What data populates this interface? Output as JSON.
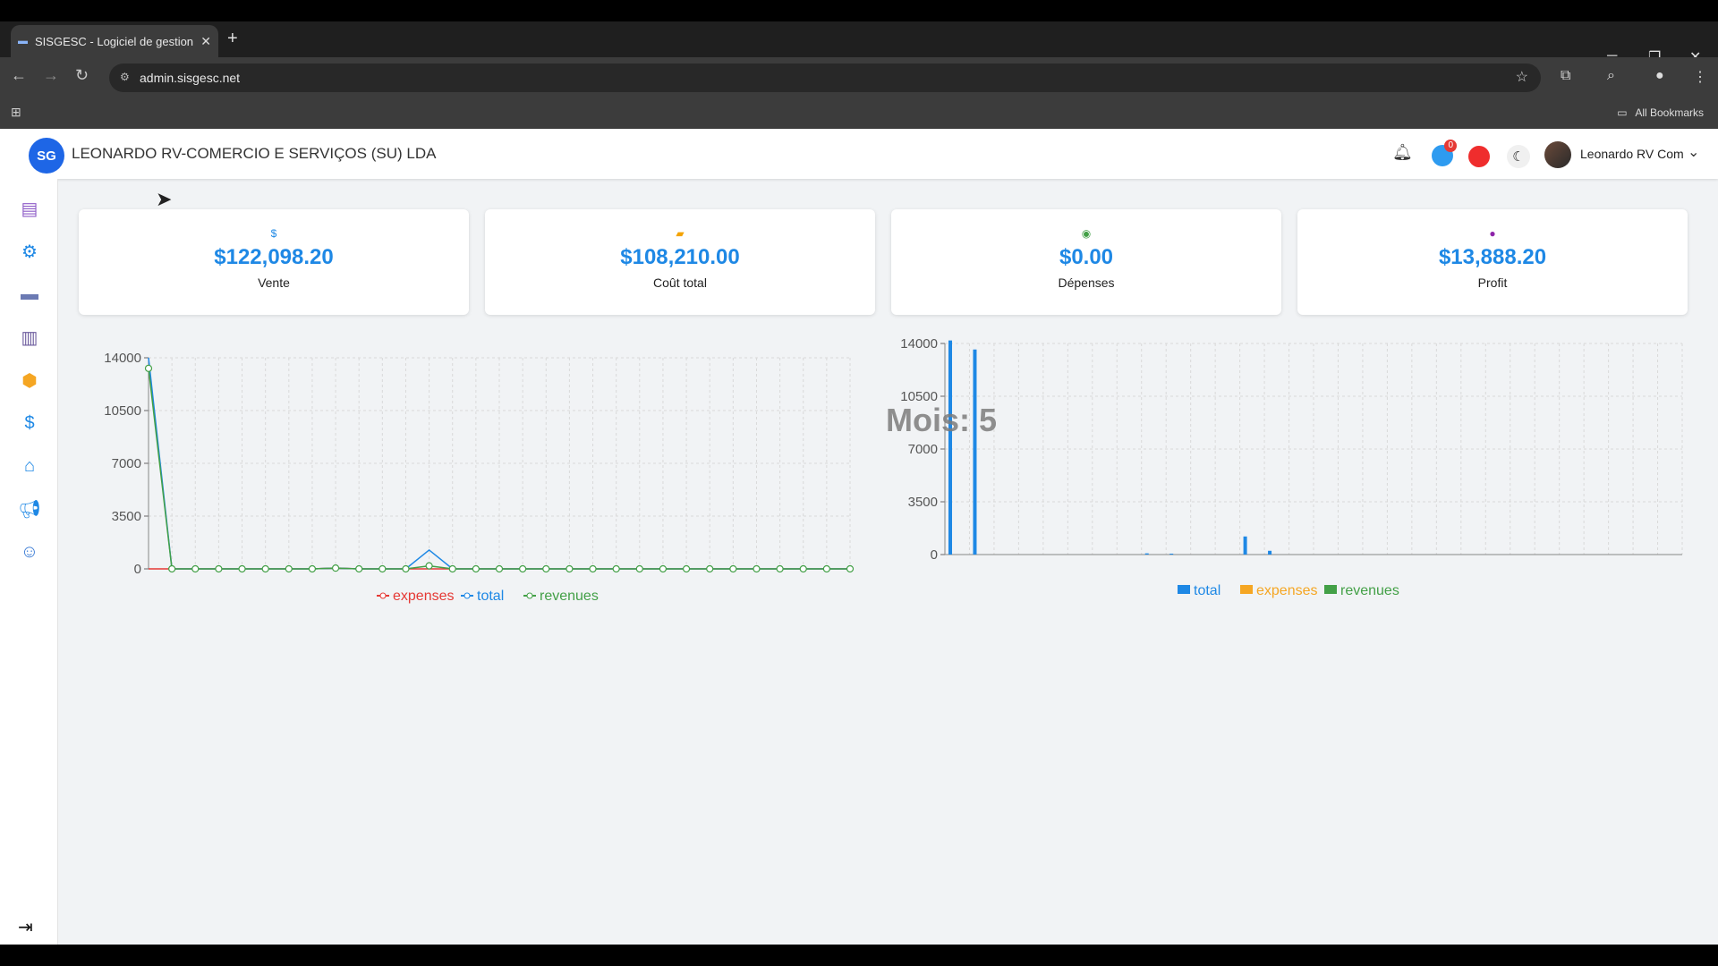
{
  "browser": {
    "tab_title": "SISGESC - Logiciel de gestion d",
    "url": "admin.sisgesc.net",
    "all_bookmarks": "All Bookmarks"
  },
  "header": {
    "logo_text": "SG",
    "company": "LEONARDO RV-COMERCIO E SERVIÇOS (SU) LDA",
    "cart_count": "0",
    "username": "Leonardo RV Com"
  },
  "cards": [
    {
      "value": "$122,098.20",
      "label": "Vente",
      "icon": "dollar-icon",
      "color": "#1e88e5"
    },
    {
      "value": "$108,210.00",
      "label": "Coût total",
      "icon": "ticket-icon",
      "color": "#f4a300"
    },
    {
      "value": "$0.00",
      "label": "Dépenses",
      "icon": "coin-icon",
      "color": "#43a047"
    },
    {
      "value": "$13,888.20",
      "label": "Profit",
      "icon": "money-bag-icon",
      "color": "#8e24aa"
    }
  ],
  "chart_data": [
    {
      "type": "line",
      "yticks": [
        "14000",
        "10500",
        "7000",
        "3500",
        "0"
      ],
      "ylim": [
        0,
        14000
      ],
      "grid": true,
      "legend_position": "bottom",
      "x_count": 31,
      "series": [
        {
          "name": "expenses",
          "color": "#e53935",
          "values": [
            0,
            0,
            0,
            0,
            0,
            0,
            0,
            0,
            60,
            0,
            0,
            0,
            0,
            0,
            0,
            0,
            0,
            0,
            0,
            0,
            0,
            0,
            0,
            0,
            0,
            0,
            0,
            0,
            0,
            0,
            0
          ]
        },
        {
          "name": "total",
          "color": "#1e88e5",
          "values": [
            14000,
            0,
            0,
            0,
            0,
            0,
            0,
            0,
            50,
            0,
            0,
            0,
            1250,
            0,
            0,
            0,
            0,
            0,
            0,
            0,
            0,
            0,
            0,
            0,
            0,
            0,
            0,
            0,
            0,
            0,
            0
          ]
        },
        {
          "name": "revenues",
          "color": "#43a047",
          "values": [
            13300,
            0,
            0,
            0,
            0,
            0,
            0,
            0,
            50,
            0,
            0,
            0,
            200,
            0,
            0,
            0,
            0,
            0,
            0,
            0,
            0,
            0,
            0,
            0,
            0,
            0,
            0,
            0,
            0,
            0,
            0
          ]
        }
      ]
    },
    {
      "type": "bar",
      "annotation": "Mois: 5",
      "yticks": [
        "14000",
        "10500",
        "7000",
        "3500",
        "0"
      ],
      "ylim": [
        0,
        14000
      ],
      "grid": true,
      "legend_position": "bottom",
      "x_count": 31,
      "series": [
        {
          "name": "total",
          "color": "#1e88e5",
          "values": [
            14200,
            13600,
            0,
            0,
            0,
            0,
            0,
            0,
            80,
            60,
            0,
            0,
            1200,
            250,
            0,
            0,
            0,
            0,
            0,
            0,
            0,
            0,
            0,
            0,
            0,
            0,
            0,
            0,
            0,
            0,
            0
          ]
        },
        {
          "name": "expenses",
          "color": "#f5a623",
          "values": [
            0,
            0,
            0,
            0,
            0,
            0,
            0,
            0,
            0,
            0,
            0,
            0,
            0,
            0,
            0,
            0,
            0,
            0,
            0,
            0,
            0,
            0,
            0,
            0,
            0,
            0,
            0,
            0,
            0,
            0,
            0
          ]
        },
        {
          "name": "revenues",
          "color": "#43a047",
          "values": [
            0,
            0,
            0,
            0,
            0,
            0,
            0,
            0,
            0,
            0,
            0,
            0,
            0,
            0,
            0,
            0,
            0,
            0,
            0,
            0,
            0,
            0,
            0,
            0,
            0,
            0,
            0,
            0,
            0,
            0,
            0
          ]
        }
      ]
    }
  ]
}
